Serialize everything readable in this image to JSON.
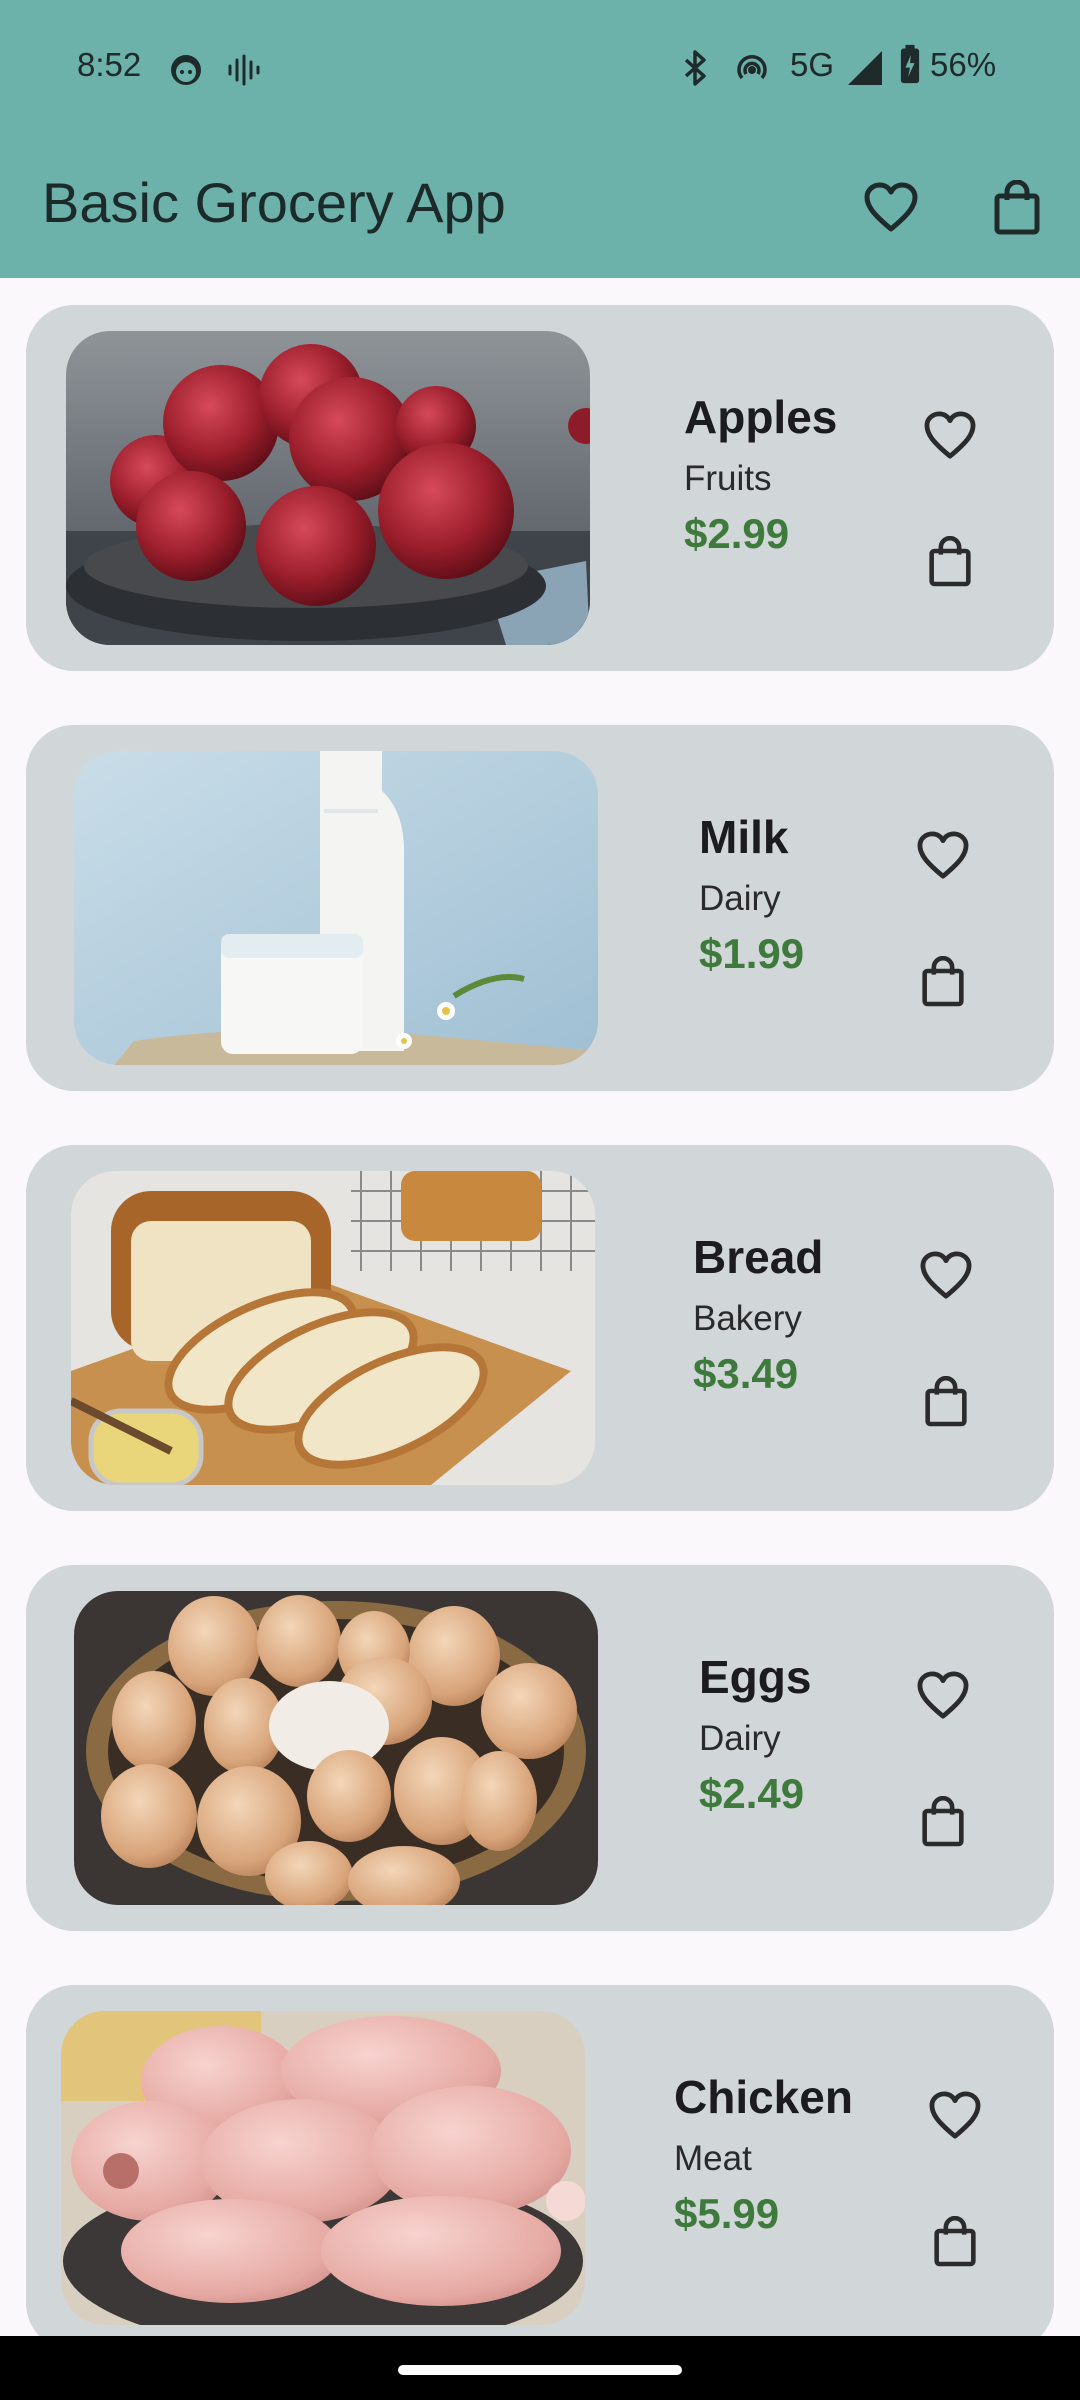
{
  "status_bar": {
    "time": "8:52",
    "network": "5G",
    "battery": "56%",
    "icons": [
      "face-icon",
      "voice-icon",
      "bluetooth-icon",
      "hotspot-icon",
      "signal-icon",
      "battery-icon"
    ]
  },
  "app_bar": {
    "title": "Basic Grocery App",
    "actions": [
      "favorites-heart-icon",
      "shopping-bag-icon"
    ],
    "color": "#6cb1aa"
  },
  "products": [
    {
      "name": "Apples",
      "category": "Fruits",
      "price": "$2.99"
    },
    {
      "name": "Milk",
      "category": "Dairy",
      "price": "$1.99"
    },
    {
      "name": "Bread",
      "category": "Bakery",
      "price": "$3.49"
    },
    {
      "name": "Eggs",
      "category": "Dairy",
      "price": "$2.49"
    },
    {
      "name": "Chicken",
      "category": "Meat",
      "price": "$5.99"
    }
  ],
  "colors": {
    "card_bg": "#d1d6d9",
    "price": "#3e7a3c",
    "page_bg": "#fbf8fc"
  }
}
